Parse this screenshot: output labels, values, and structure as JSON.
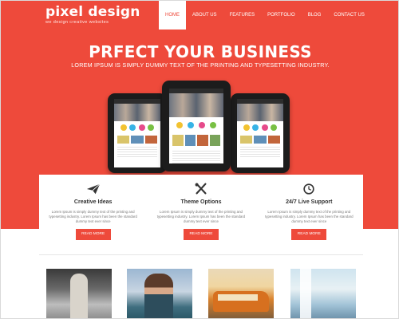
{
  "colors": {
    "accent": "#ee4a3b",
    "white": "#ffffff"
  },
  "logo": {
    "title": "pixel design",
    "tagline": "we design creative websites"
  },
  "nav": {
    "items": [
      {
        "label": "HOME",
        "active": true
      },
      {
        "label": "ABOUT US",
        "active": false
      },
      {
        "label": "FEATURES",
        "active": false
      },
      {
        "label": "PORTFOLIO",
        "active": false
      },
      {
        "label": "BLOG",
        "active": false
      },
      {
        "label": "CONTACT US",
        "active": false
      }
    ]
  },
  "hero": {
    "title": "PRFECT YOUR BUSINESS",
    "subtitle": "LOREM IPSUM IS SIMPLY DUMMY TEXT OF THE PRINTING AND TYPESETTING INDUSTRY."
  },
  "features": [
    {
      "icon": "paper-plane-icon",
      "title": "Creative Ideas",
      "text": "Lorem Ipsum is simply dummy text of the printing and typesetting industry. Lorem Ipsum has been the standard dummy text ever since",
      "button": "READ MORE"
    },
    {
      "icon": "tools-icon",
      "title": "Theme Options",
      "text": "Lorem Ipsum is simply dummy text of the printing and typesetting industry. Lorem Ipsum has been the standard dummy text ever since",
      "button": "READ MORE"
    },
    {
      "icon": "clock-icon",
      "title": "24/7 Live Support",
      "text": "Lorem Ipsum is simply dummy text of the printing and typesetting industry. Lorem Ipsum has been the standard dummy text ever since",
      "button": "READ MORE"
    }
  ],
  "gallery": [
    {
      "icon": "portrait-photo"
    },
    {
      "icon": "fashion-photo"
    },
    {
      "icon": "vintage-bus-photo"
    },
    {
      "icon": "beach-window-photo"
    }
  ]
}
